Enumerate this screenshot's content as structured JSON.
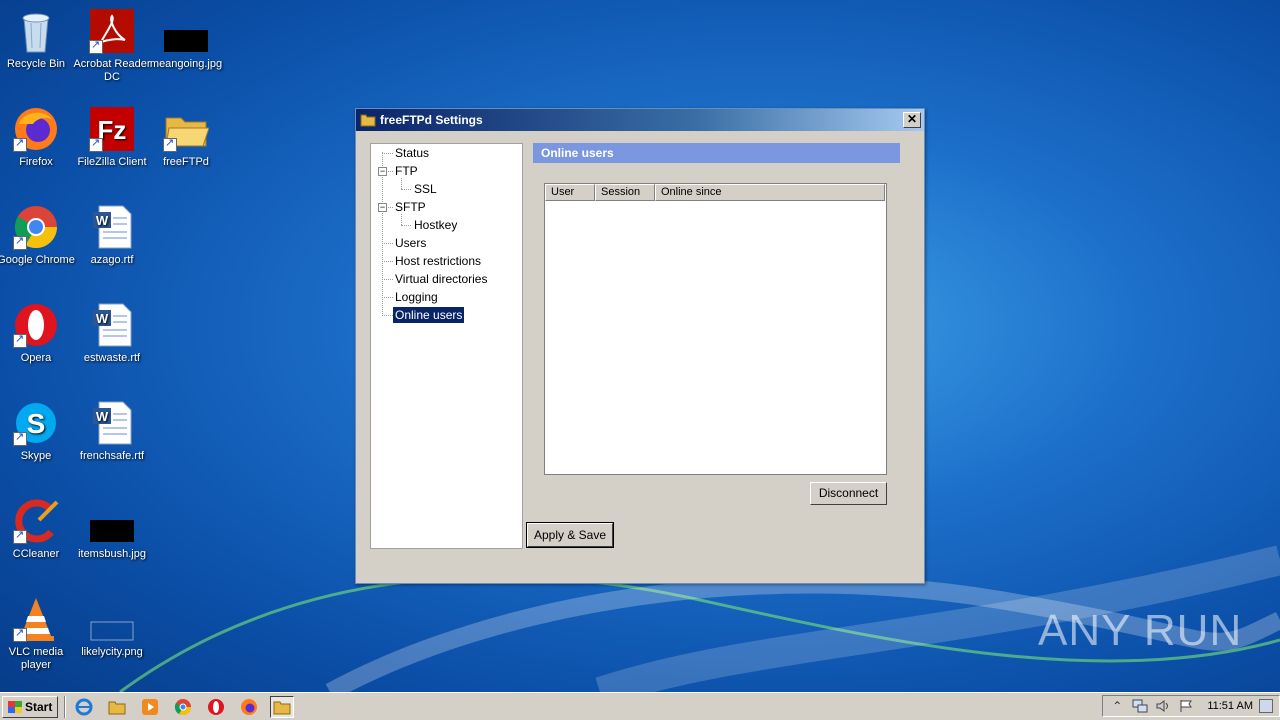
{
  "desktop": {
    "icons": [
      {
        "label": "Recycle Bin"
      },
      {
        "label": "Acrobat Reader DC"
      },
      {
        "label": "meangoing.jpg"
      },
      {
        "label": "Firefox"
      },
      {
        "label": "FileZilla Client"
      },
      {
        "label": "freeFTPd"
      },
      {
        "label": "Google Chrome"
      },
      {
        "label": "azago.rtf"
      },
      {
        "label": "Opera"
      },
      {
        "label": "estwaste.rtf"
      },
      {
        "label": "Skype"
      },
      {
        "label": "frenchsafe.rtf"
      },
      {
        "label": "CCleaner"
      },
      {
        "label": "itemsbush.jpg"
      },
      {
        "label": "VLC media player"
      },
      {
        "label": "likelycity.png"
      }
    ]
  },
  "window": {
    "title": "freeFTPd Settings",
    "close_label": "✕",
    "tree": [
      {
        "label": "Status"
      },
      {
        "label": "FTP"
      },
      {
        "label": "SSL"
      },
      {
        "label": "SFTP"
      },
      {
        "label": "Hostkey"
      },
      {
        "label": "Users"
      },
      {
        "label": "Host restrictions"
      },
      {
        "label": "Virtual directories"
      },
      {
        "label": "Logging"
      },
      {
        "label": "Online users"
      }
    ],
    "selected_tree_item": "Online users",
    "panel_title": "Online users",
    "list_columns": [
      "User",
      "Session",
      "Online since"
    ],
    "disconnect_label": "Disconnect",
    "apply_label": "Apply & Save"
  },
  "taskbar": {
    "start_label": "Start",
    "quick_launch": [
      "internet-explorer-icon",
      "explorer-icon",
      "media-player-icon",
      "chrome-icon",
      "opera-icon",
      "firefox-icon",
      "freeftpd-icon"
    ],
    "clock": "11:51 AM"
  },
  "watermark": "ANY RUN",
  "colors": {
    "title_active": "#0a246a",
    "panel_header": "#7a97e0",
    "selection": "#0a246a"
  }
}
